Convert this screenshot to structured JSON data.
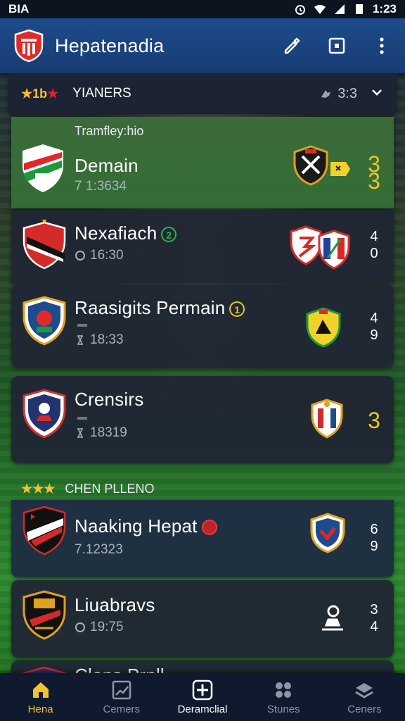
{
  "status_bar": {
    "left": "BIA",
    "time": "1:23"
  },
  "app_bar": {
    "title": "Hepatenadia"
  },
  "filter": {
    "stars": "★1b",
    "star_red": "★",
    "label": "YIANERS",
    "count": "3:3"
  },
  "sections": {
    "first": "Tramfley:hio",
    "second_stars": "★★★",
    "second": "CHEN PLLENO"
  },
  "matches": [
    {
      "name": "Demain",
      "time": "7 1:3634",
      "score_top": "3",
      "score_bottom": "3",
      "badge": ""
    },
    {
      "name": "Nexafiach",
      "time": "16:30",
      "score_top": "4",
      "score_bottom": "0",
      "badge": "2"
    },
    {
      "name": "Raasigits Permain",
      "time": "18:33",
      "score_top": "4",
      "score_bottom": "9",
      "badge": "1"
    },
    {
      "name": "Crensirs",
      "time": "18319",
      "score_top": "3",
      "score_bottom": "",
      "badge": ""
    },
    {
      "name": "Naaking Hepat",
      "time": "7.12323",
      "score_top": "6",
      "score_bottom": "9",
      "badge": ""
    },
    {
      "name": "Liuabravs",
      "time": "19:75",
      "score_top": "3",
      "score_bottom": "4",
      "badge": ""
    },
    {
      "name": "Clens Prnll",
      "time": "",
      "score_top": "",
      "score_bottom": "",
      "badge": ""
    }
  ],
  "nav": [
    {
      "label": "Hena",
      "icon": "home-icon"
    },
    {
      "label": "Cemers",
      "icon": "chart-icon"
    },
    {
      "label": "Deramclial",
      "icon": "plus-icon"
    },
    {
      "label": "Stunes",
      "icon": "grid-icon"
    },
    {
      "label": "Ceners",
      "icon": "layers-icon"
    }
  ],
  "colors": {
    "accent": "#f2c230",
    "app_bar": "#1e4b8c",
    "highlight_card": "#336d35",
    "card": "#202634"
  }
}
